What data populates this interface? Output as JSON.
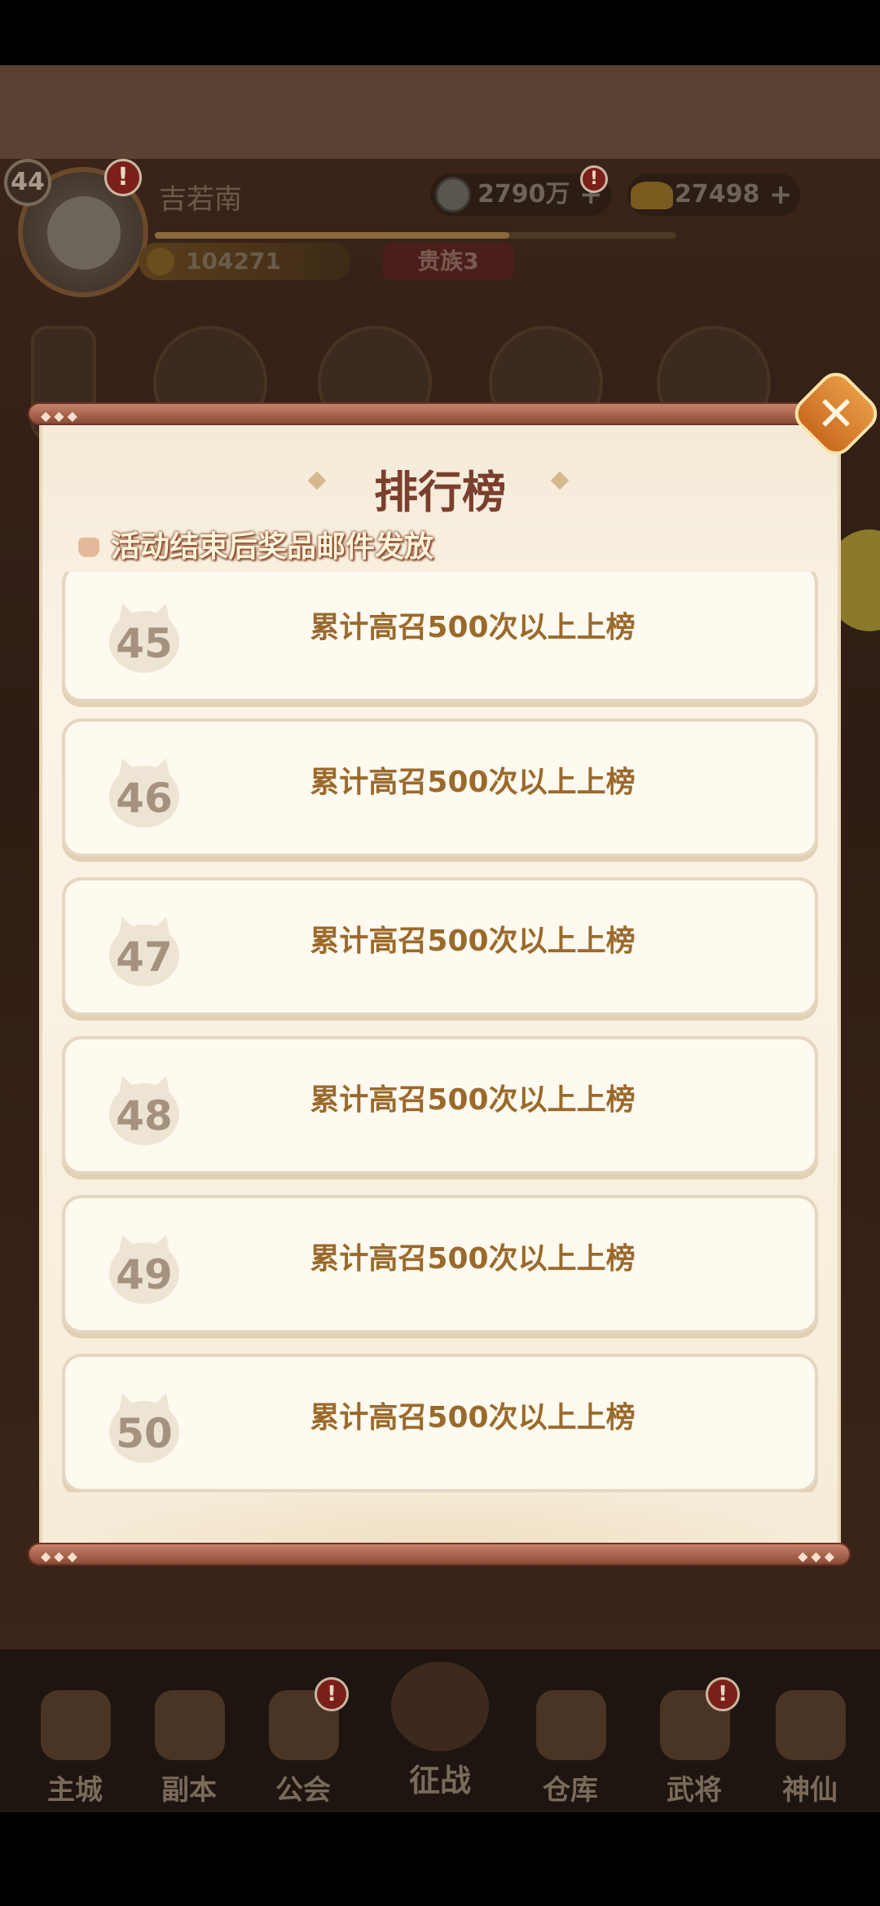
{
  "hud": {
    "level": "44",
    "player_name": "吉若南",
    "copper": "2790万",
    "gold": "27498",
    "power": "104271",
    "noble_rank": "贵族3",
    "alert_mark": "!",
    "plus": "+",
    "xp_progress": 0.68
  },
  "modal": {
    "title": "排行榜",
    "subtitle": "活动结束后奖品邮件发放",
    "close_label": "✕",
    "rows": [
      {
        "rank": "45",
        "text": "累计高召500次以上上榜"
      },
      {
        "rank": "46",
        "text": "累计高召500次以上上榜"
      },
      {
        "rank": "47",
        "text": "累计高召500次以上上榜"
      },
      {
        "rank": "48",
        "text": "累计高召500次以上上榜"
      },
      {
        "rank": "49",
        "text": "累计高召500次以上上榜"
      },
      {
        "rank": "50",
        "text": "累计高召500次以上上榜"
      }
    ]
  },
  "bottom_nav": {
    "items": [
      {
        "label": "主城",
        "icon": "castle-icon"
      },
      {
        "label": "副本",
        "icon": "sword-icon"
      },
      {
        "label": "公会",
        "icon": "flag-icon"
      },
      {
        "label": "征战",
        "icon": "battle-icon"
      },
      {
        "label": "仓库",
        "icon": "bag-icon"
      },
      {
        "label": "武将",
        "icon": "cat-general-icon"
      },
      {
        "label": "神仙",
        "icon": "cat-immortal-icon"
      }
    ]
  },
  "colors": {
    "panel_bg": "#fbf4e6",
    "title": "#7b3f2e",
    "row_text": "#9a6a2c",
    "rank_text": "#a5927e",
    "close_button": "#d9812e"
  }
}
